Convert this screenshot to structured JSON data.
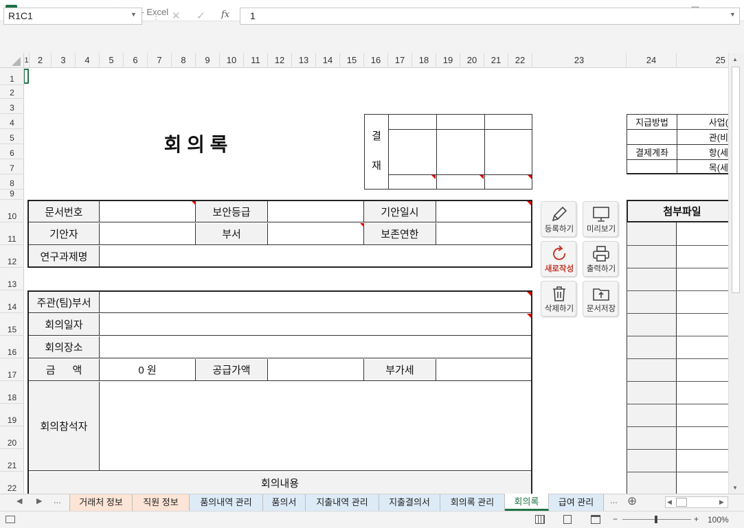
{
  "window": {
    "title": "사업(과제) 관리 프로그램.xlsm - Excel",
    "app_icon": "X",
    "minimize": "—",
    "maximize": "☐",
    "close": "✕"
  },
  "formula_bar": {
    "name_box": "R1C1",
    "fx": "fx",
    "value": "1"
  },
  "columns": [
    "1",
    "2",
    "3",
    "4",
    "5",
    "6",
    "7",
    "8",
    "9",
    "10",
    "11",
    "12",
    "13",
    "14",
    "15",
    "16",
    "17",
    "18",
    "19",
    "20",
    "21",
    "22",
    "23",
    "24",
    "25"
  ],
  "rows": [
    "1",
    "2",
    "3",
    "4",
    "5",
    "6",
    "7",
    "8",
    "9",
    "10",
    "11",
    "12",
    "13",
    "14",
    "15",
    "16",
    "17",
    "18",
    "19",
    "20",
    "21",
    "22"
  ],
  "form": {
    "title": "회 의 록",
    "approval_label_1": "결",
    "approval_label_2": "재",
    "doc_number": "문서번호",
    "security_level": "보안등급",
    "draft_date": "기안일시",
    "drafter": "기안자",
    "department": "부서",
    "retention": "보존연한",
    "project_name": "연구과제명",
    "host_department": "주관(팀)부서",
    "meeting_date": "회의일자",
    "meeting_place": "회의장소",
    "amount": "금      액",
    "amount_value": "0 원",
    "supply_amount": "공급가액",
    "vat": "부가세",
    "attendees": "회의참석자",
    "meeting_content": "회의내용"
  },
  "side_table": {
    "payment_method": "지급방법",
    "payment_account": "결제계좌",
    "budget_1": "사업(과",
    "budget_2": "관(비목",
    "budget_3": "항(세목",
    "budget_4": "목(세세",
    "attachments": "첨부파일"
  },
  "buttons": {
    "register": "등록하기",
    "preview": "미리보기",
    "new": "새로작성",
    "print": "출력하기",
    "delete": "삭제하기",
    "save": "문서저장"
  },
  "tabs": [
    {
      "label": "거래처 정보",
      "color": "#fce4d6"
    },
    {
      "label": "직원 정보",
      "color": "#fce4d6"
    },
    {
      "label": "품의내역 관리",
      "color": "#ddebf7"
    },
    {
      "label": "품의서",
      "color": "#ddebf7"
    },
    {
      "label": "지출내역 관리",
      "color": "#ddebf7"
    },
    {
      "label": "지출결의서",
      "color": "#ddebf7"
    },
    {
      "label": "회의록 관리",
      "color": "#ddebf7"
    },
    {
      "label": "회의록",
      "color": "#ffffff"
    },
    {
      "label": "급여 관리",
      "color": "#ddebf7"
    }
  ],
  "tab_nav": {
    "prev": "◀",
    "next": "▶",
    "more": "...",
    "more_right": "...",
    "add": "⊕"
  },
  "status": {
    "zoom": "100%",
    "minus": "−",
    "plus": "+"
  },
  "colors": {
    "accent": "#217346",
    "new_button_red": "#c0392b",
    "label_fill": "#f2f2f2"
  }
}
